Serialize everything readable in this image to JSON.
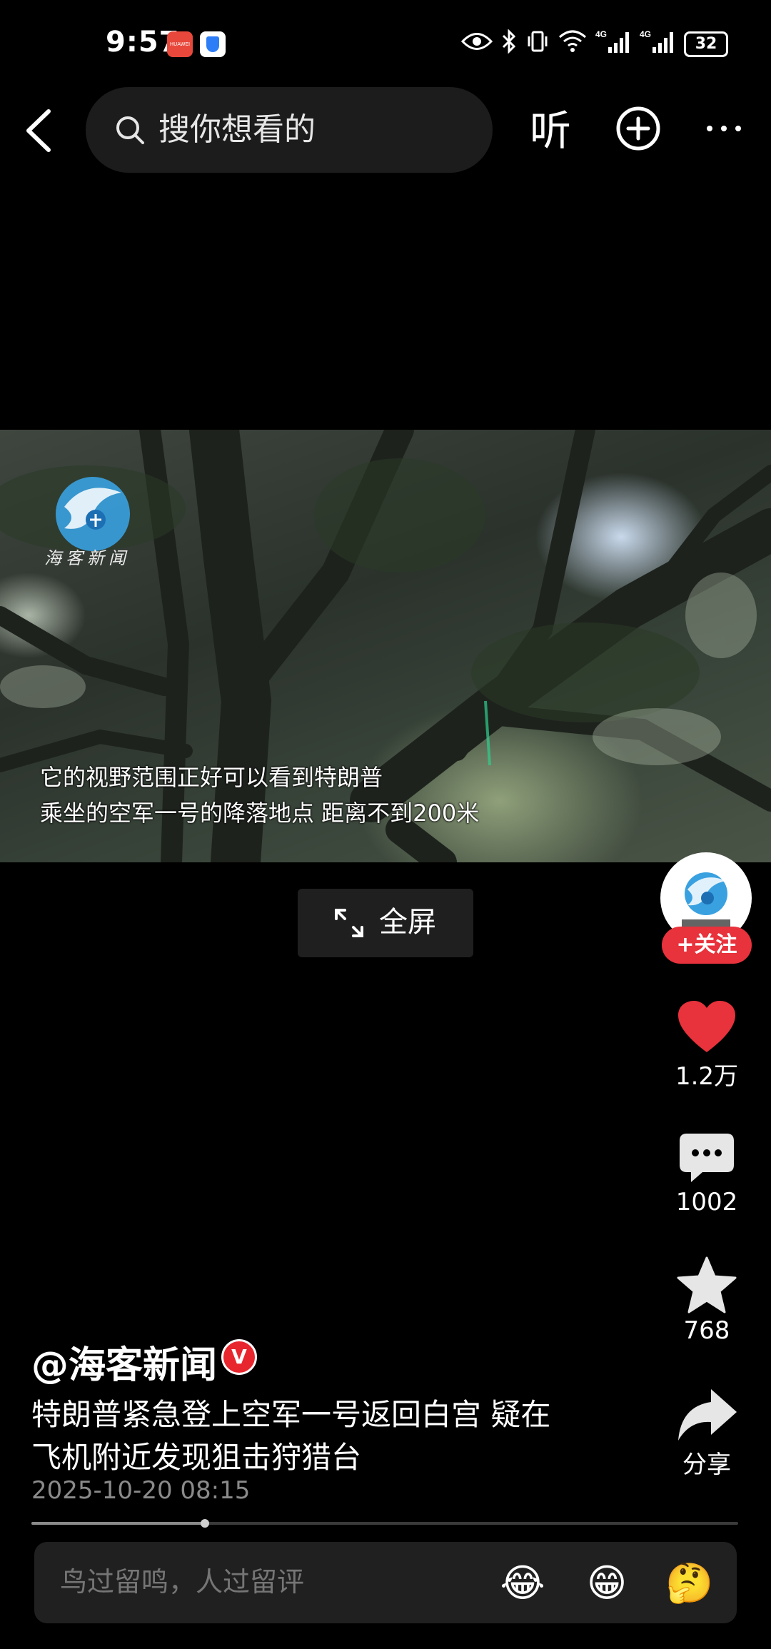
{
  "status_bar": {
    "time": "9:57",
    "battery": "32"
  },
  "top_nav": {
    "search_placeholder": "搜你想看的",
    "listen_label": "听"
  },
  "video": {
    "watermark_text": "海客新闻",
    "subtitle_line1": "它的视野范围正好可以看到特朗普",
    "subtitle_line2": "乘坐的空军一号的降落地点 距离不到200米",
    "fullscreen_label": "全屏"
  },
  "right_rail": {
    "follow_label": "+关注",
    "likes": "1.2万",
    "comments": "1002",
    "favorites": "768",
    "share_label": "分享",
    "like_color": "#e8323c"
  },
  "post": {
    "author": "@海客新闻",
    "verified_label": "V",
    "description_line1": "特朗普紧急登上空军一号返回白宫 疑在",
    "description_line2": "飞机附近发现狙击狩猎台",
    "date": "2025-10-20 08:15",
    "progress": 0.245
  },
  "comment_bar": {
    "placeholder": "鸟过留鸣，人过留评",
    "emojis": [
      "😂",
      "😁",
      "🤔"
    ]
  }
}
